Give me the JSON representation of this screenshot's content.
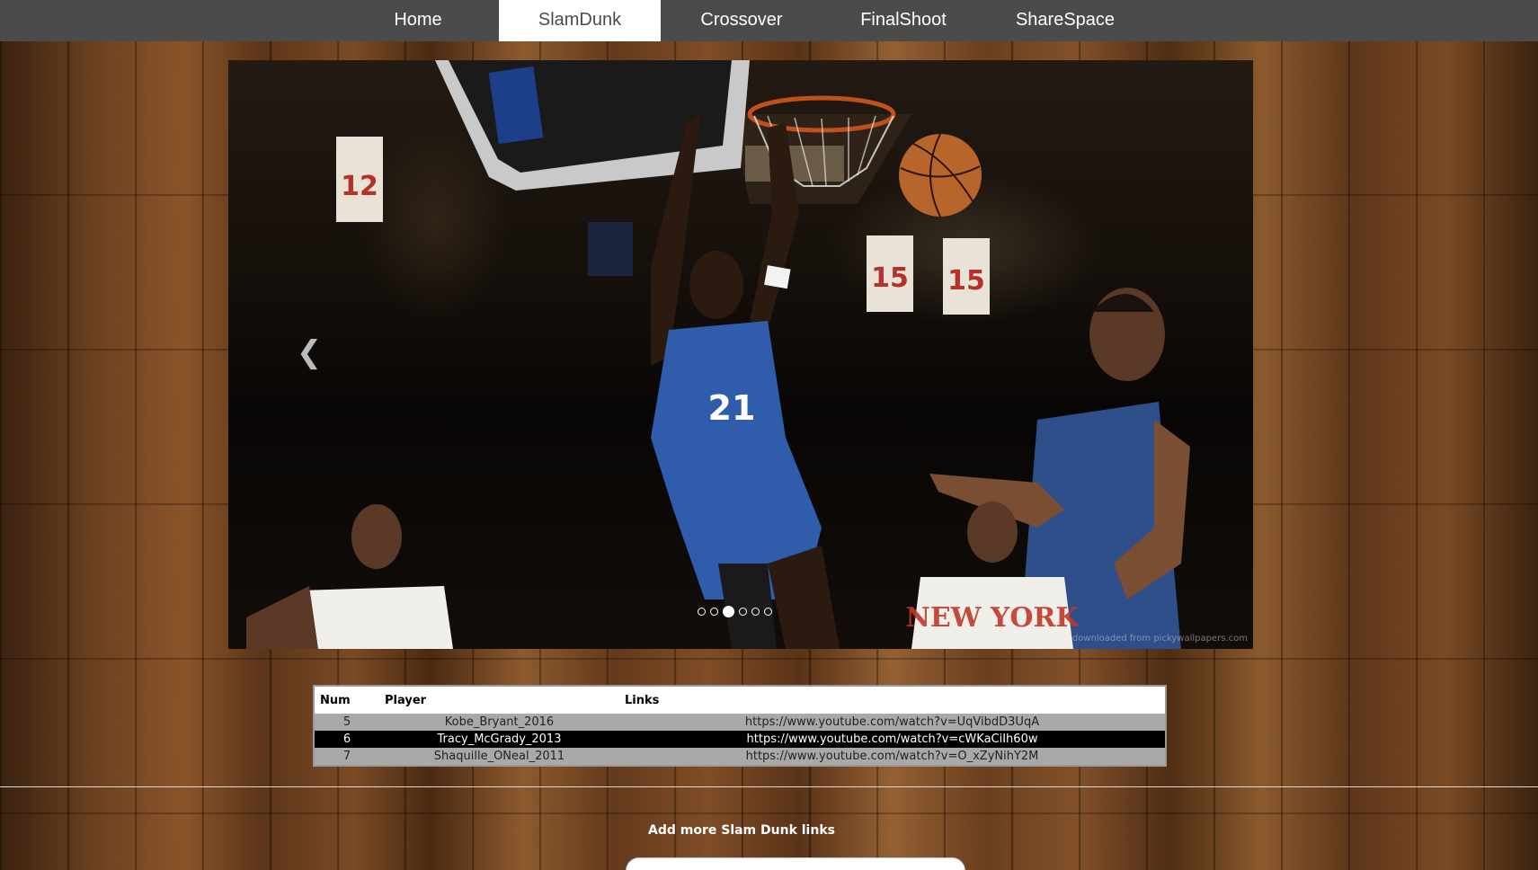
{
  "nav": {
    "items": [
      {
        "label": "Home"
      },
      {
        "label": "SlamDunk"
      },
      {
        "label": "Crossover"
      },
      {
        "label": "FinalShoot"
      },
      {
        "label": "ShareSpace"
      }
    ],
    "active_index": 1,
    "colors": {
      "bar": "#4b4b4b",
      "active_bg": "#ffffff"
    }
  },
  "carousel": {
    "prev_icon": "chevron-left-icon",
    "slide_count": 6,
    "active_slide": 3,
    "banners": [
      "12",
      "15",
      "15"
    ],
    "jersey_number": "21",
    "watermark": "downloaded from pickywallpapers.com"
  },
  "table": {
    "headers": {
      "num": "Num",
      "player": "Player",
      "links": "Links"
    },
    "rows": [
      {
        "num": "5",
        "player": "Kobe_Bryant_2016",
        "link": "https://www.youtube.com/watch?v=UqVibdD3UqA"
      },
      {
        "num": "6",
        "player": "Tracy_McGrady_2013",
        "link": "https://www.youtube.com/watch?v=cWKaCiIh60w"
      },
      {
        "num": "7",
        "player": "Shaquille_ONeal_2011",
        "link": "https://www.youtube.com/watch?v=O_xZyNihY2M"
      }
    ],
    "selected_row": 1
  },
  "add_section": {
    "heading": "Add more Slam Dunk links",
    "input_placeholder": ""
  }
}
